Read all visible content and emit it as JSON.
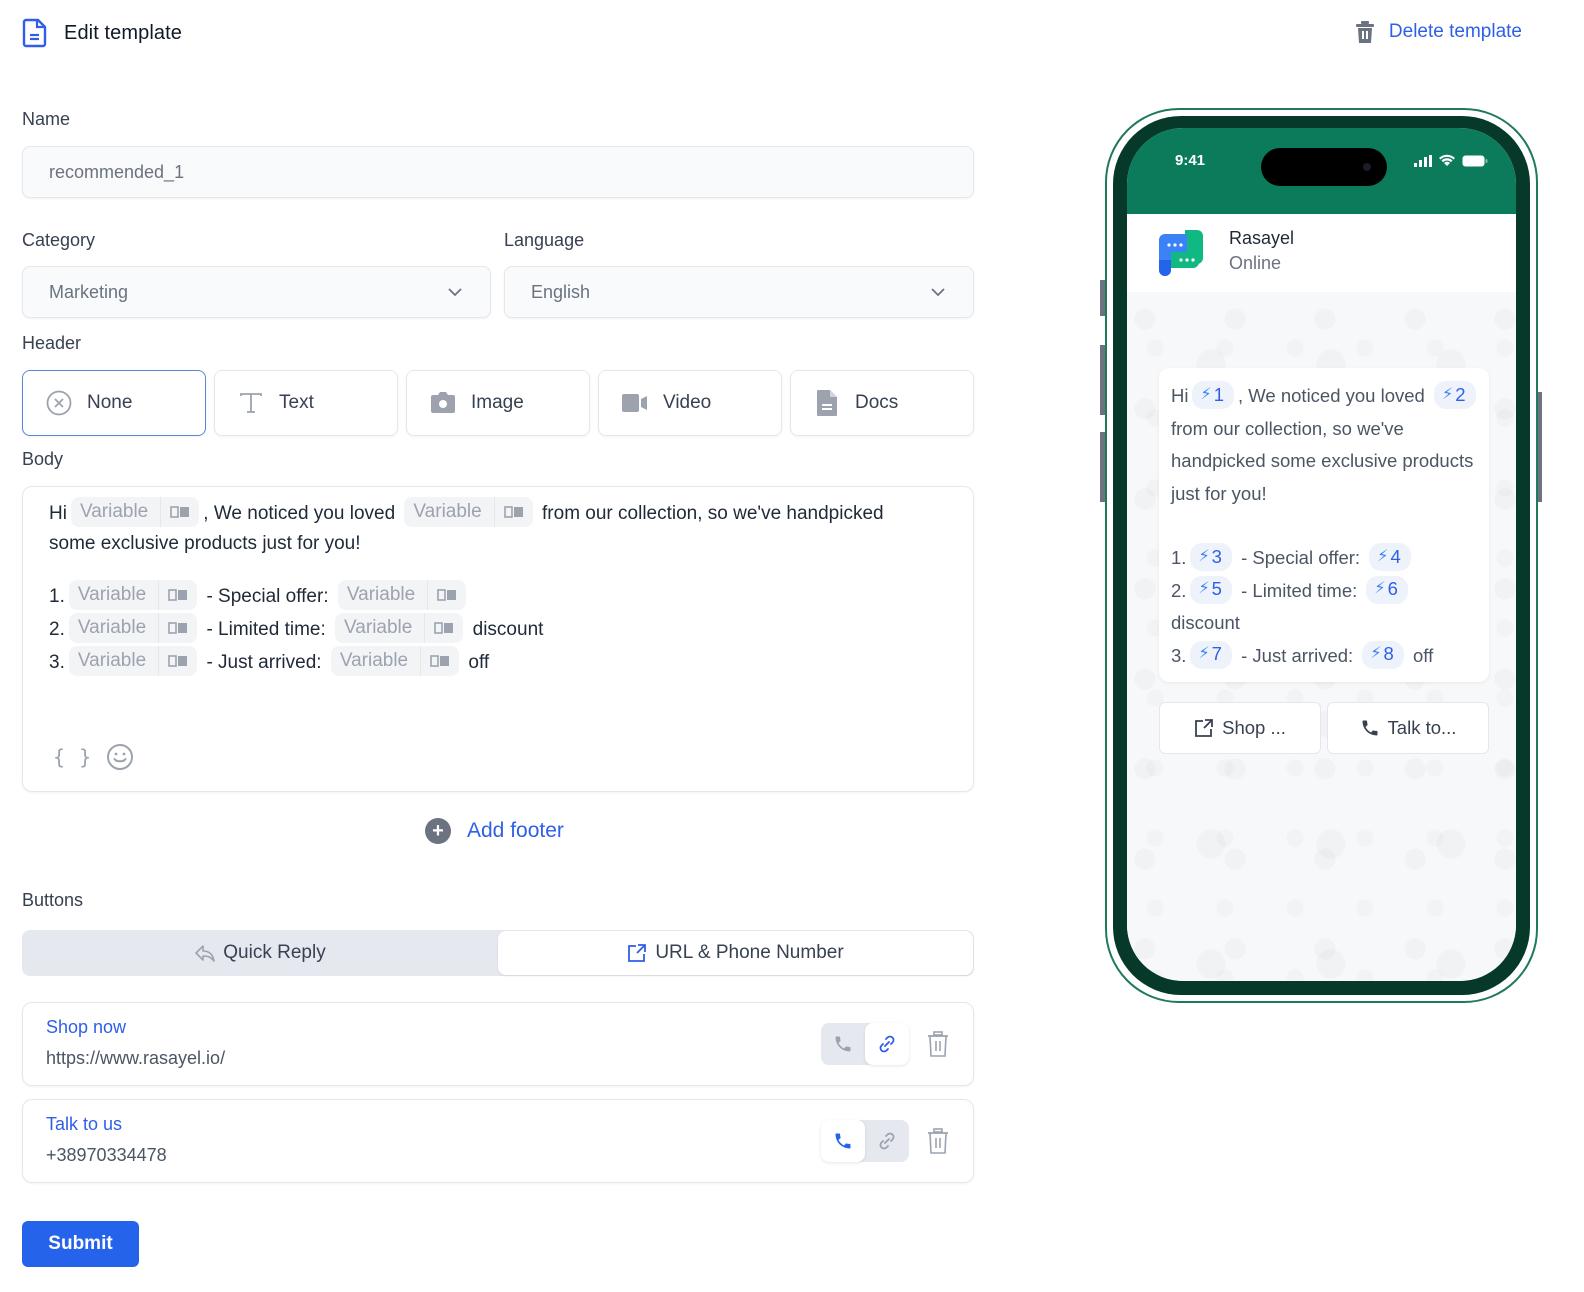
{
  "header": {
    "title": "Edit template",
    "delete_label": "Delete template"
  },
  "form": {
    "name_label": "Name",
    "name_value": "recommended_1",
    "category_label": "Category",
    "category_value": "Marketing",
    "language_label": "Language",
    "language_value": "English",
    "header_label": "Header",
    "header_options": [
      {
        "label": "None",
        "icon": "close-circle-icon",
        "selected": true
      },
      {
        "label": "Text",
        "icon": "text-icon",
        "selected": false
      },
      {
        "label": "Image",
        "icon": "camera-icon",
        "selected": false
      },
      {
        "label": "Video",
        "icon": "video-icon",
        "selected": false
      },
      {
        "label": "Docs",
        "icon": "document-icon",
        "selected": false
      }
    ],
    "body_label": "Body",
    "body": {
      "variable_placeholder": "Variable",
      "line1": {
        "hi": "Hi",
        "p1": ", We noticed you loved",
        "p2": "from our collection, so we've handpicked"
      },
      "line2": "some exclusive products just for you!",
      "item1": {
        "num": "1.",
        "mid": "- Special offer:",
        "end": ""
      },
      "item2": {
        "num": "2.",
        "mid": "- Limited time:",
        "end": "discount"
      },
      "item3": {
        "num": "3.",
        "mid": "- Just arrived:",
        "end": "off"
      },
      "tools": {
        "variable_icon": "{ }",
        "emoji_icon": "emoji-icon"
      }
    },
    "add_footer_label": "Add footer",
    "buttons_label": "Buttons",
    "button_tabs": [
      {
        "label": "Quick Reply",
        "active": false
      },
      {
        "label": "URL & Phone Number",
        "active": true
      }
    ],
    "button_items": [
      {
        "name": "Shop now",
        "value": "https://www.rasayel.io/",
        "type": "url"
      },
      {
        "name": "Talk to us",
        "value": "+38970334478",
        "type": "phone"
      }
    ],
    "submit_label": "Submit"
  },
  "preview": {
    "time": "9:41",
    "contact_name": "Rasayel",
    "contact_status": "Online",
    "message": {
      "hi": "Hi",
      "v1": "1",
      "p1": ", We noticed you loved",
      "v2": "2",
      "p2": "from our collection, so we've handpicked some exclusive products just for you!",
      "items": [
        {
          "num": "1.",
          "va": "3",
          "mid": "- Special offer:",
          "vb": "4",
          "end": ""
        },
        {
          "num": "2.",
          "va": "5",
          "mid": "- Limited time:",
          "vb": "6",
          "end": "discount"
        },
        {
          "num": "3.",
          "va": "7",
          "mid": "- Just arrived:",
          "vb": "8",
          "end": "off"
        }
      ]
    },
    "buttons": [
      {
        "label": "Shop ...",
        "icon": "external-link-icon"
      },
      {
        "label": "Talk to...",
        "icon": "phone-icon"
      }
    ]
  },
  "colors": {
    "accent": "#2f5fe8",
    "submit": "#2563eb",
    "phone_header": "#0b7b5c",
    "phone_frame": "#06392a"
  }
}
